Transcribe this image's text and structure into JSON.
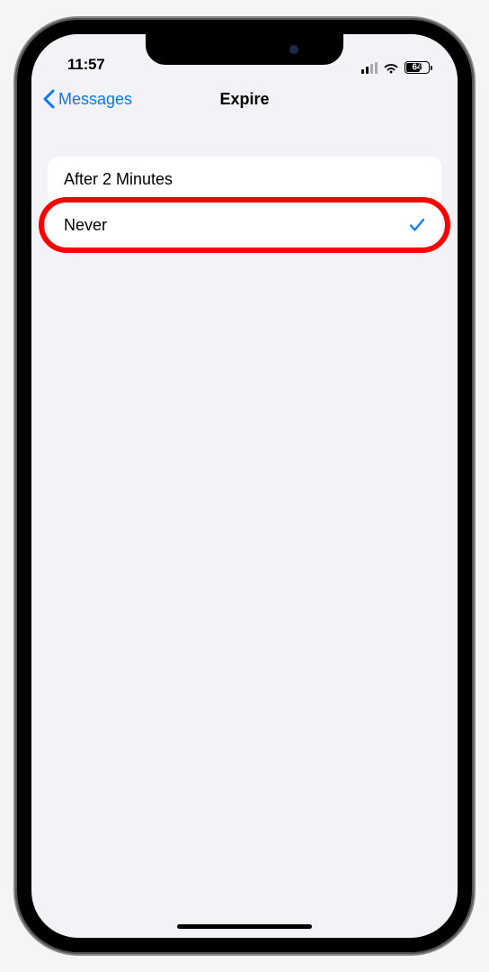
{
  "status_bar": {
    "time": "11:57",
    "battery_percent": "64"
  },
  "nav": {
    "back_label": "Messages",
    "title": "Expire"
  },
  "options": [
    {
      "label": "After 2 Minutes",
      "selected": false,
      "highlighted": false
    },
    {
      "label": "Never",
      "selected": true,
      "highlighted": true
    }
  ]
}
